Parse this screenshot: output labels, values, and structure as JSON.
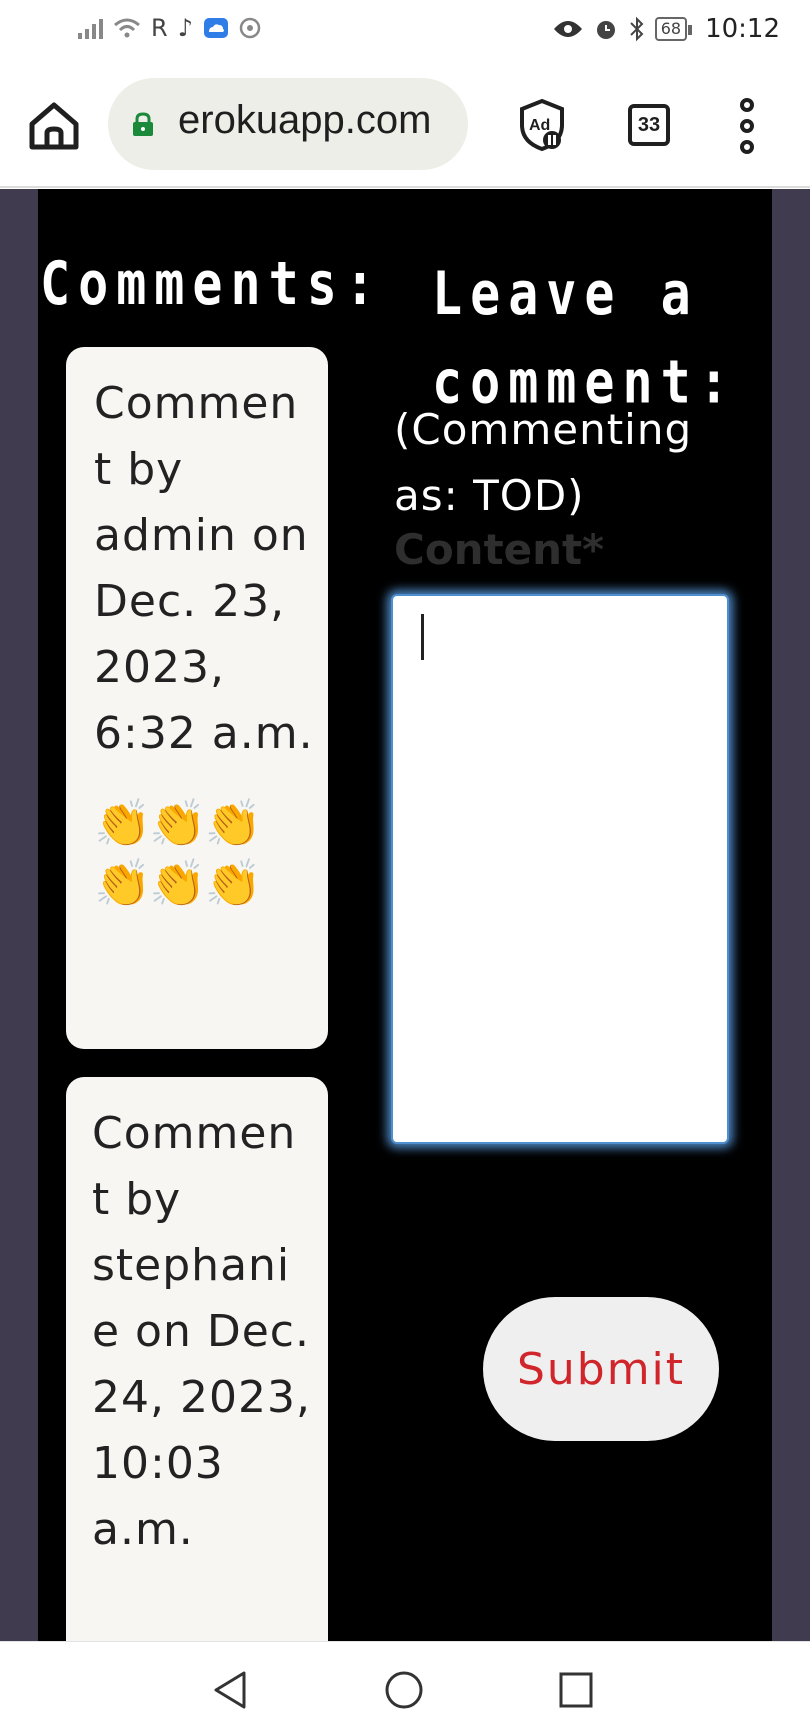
{
  "status_bar": {
    "time": "10:12",
    "battery": "68",
    "left_glyphs": [
      "R",
      "♪"
    ]
  },
  "browser": {
    "url": "erokuapp.com",
    "tab_count": "33",
    "icons": [
      "home-icon",
      "lock-icon",
      "ad-block-icon",
      "tabs-icon",
      "more-menu-icon"
    ]
  },
  "page": {
    "comments_heading": "Comments:",
    "comments": [
      {
        "meta": "Comment by admin on Dec. 23, 2023, 6:32 a.m.",
        "body": "👏👏👏👏👏👏"
      },
      {
        "meta": "Comment by stephanie on Dec. 24, 2023, 10:03 a.m.",
        "body": ""
      }
    ],
    "leave_heading": "Leave a comment:",
    "commenting_as": "(Commenting as: TOD)",
    "content_label": "Content*",
    "content_value": "",
    "submit_label": "Submit"
  },
  "colors": {
    "page_bg": "#000000",
    "side_bg": "#413b4f",
    "card_bg": "#f7f6f3",
    "submit_text": "#d0252b",
    "focus_ring": "#4e8fd0"
  },
  "nav_bar": {
    "icons": [
      "back-icon",
      "home-circle-icon",
      "recents-icon"
    ]
  }
}
